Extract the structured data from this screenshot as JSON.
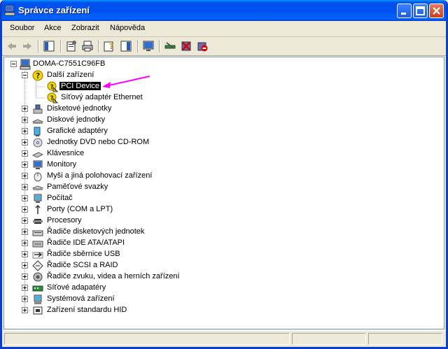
{
  "window": {
    "title": "Správce zařízení"
  },
  "menu": [
    "Soubor",
    "Akce",
    "Zobrazit",
    "Nápověda"
  ],
  "toolbar_icons": [
    "back-icon",
    "forward-icon",
    "console-tree-icon",
    "properties-icon",
    "print-icon",
    "help-icon",
    "view-icon",
    "monitor-icon",
    "scan-hardware-icon",
    "uninstall-icon",
    "disable-icon"
  ],
  "tree": {
    "root": "DOMA-C7551C96FB",
    "items": [
      {
        "label": "Další zařízení",
        "icon": "question-icon",
        "expanded": true,
        "children": [
          {
            "label": "PCI Device",
            "icon": "warning-device-icon",
            "selected": true
          },
          {
            "label": "Síťový adaptér Ethernet",
            "icon": "warning-device-icon"
          }
        ]
      },
      {
        "label": "Disketové jednotky",
        "icon": "floppy-drive-icon"
      },
      {
        "label": "Diskové jednotky",
        "icon": "disk-drive-icon"
      },
      {
        "label": "Grafické adaptéry",
        "icon": "display-adapter-icon"
      },
      {
        "label": "Jednotky DVD nebo CD-ROM",
        "icon": "cdrom-icon"
      },
      {
        "label": "Klávesnice",
        "icon": "keyboard-icon"
      },
      {
        "label": "Monitory",
        "icon": "monitor-icon"
      },
      {
        "label": "Myši a jiná polohovací zařízení",
        "icon": "mouse-icon"
      },
      {
        "label": "Paměťové svazky",
        "icon": "storage-volume-icon"
      },
      {
        "label": "Počítač",
        "icon": "computer-icon"
      },
      {
        "label": "Porty (COM a LPT)",
        "icon": "port-icon"
      },
      {
        "label": "Procesory",
        "icon": "processor-icon"
      },
      {
        "label": "Řadiče disketových jednotek",
        "icon": "floppy-controller-icon"
      },
      {
        "label": "Řadiče IDE ATA/ATAPI",
        "icon": "ide-controller-icon"
      },
      {
        "label": "Řadiče sběrnice USB",
        "icon": "usb-icon"
      },
      {
        "label": "Řadiče SCSI a RAID",
        "icon": "scsi-icon"
      },
      {
        "label": "Řadiče zvuku, videa a herních zařízení",
        "icon": "sound-icon"
      },
      {
        "label": "Síťové adapatéry",
        "icon": "network-adapter-icon"
      },
      {
        "label": "Systémová zařízení",
        "icon": "system-device-icon"
      },
      {
        "label": "Zařízení standardu HID",
        "icon": "hid-icon"
      }
    ]
  },
  "colors": {
    "titlebar": "#0054e3",
    "selection": "#000000",
    "annotation_arrow": "#ff00ff"
  }
}
